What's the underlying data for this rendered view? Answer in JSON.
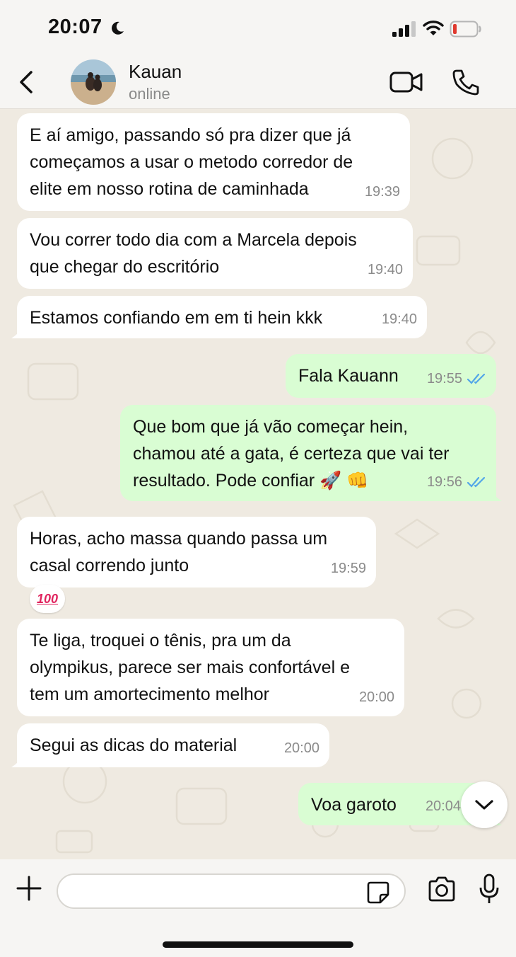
{
  "status_bar": {
    "time": "20:07"
  },
  "header": {
    "contact_name": "Kauan",
    "contact_status": "online"
  },
  "messages": [
    {
      "direction": "in",
      "text": "E aí amigo, passando só pra dizer que já\ncomeçamos a usar o metodo corredor de\nelite em nosso rotina de caminhada",
      "time": "19:39"
    },
    {
      "direction": "in",
      "text": "Vou correr todo dia com a Marcela depois\nque chegar do escritório",
      "time": "19:40"
    },
    {
      "direction": "in",
      "text": "Estamos confiando em em ti hein kkk",
      "time": "19:40"
    },
    {
      "direction": "out",
      "text": "Fala Kauann",
      "time": "19:55"
    },
    {
      "direction": "out",
      "text": "Que bom que já vão começar hein,\nchamou até a gata, é certeza que vai ter\nresultado. Pode confiar 🚀 👊",
      "time": "19:56"
    },
    {
      "direction": "in",
      "text": "Horas, acho massa quando passa um\ncasal correndo junto",
      "time": "19:59",
      "reaction": "💯"
    },
    {
      "direction": "in",
      "text": "Te liga, troquei o tênis, pra um da\nolympikus, parece ser mais confortável e\ntem um amortecimento melhor",
      "time": "20:00"
    },
    {
      "direction": "in",
      "text": "Segui as dicas do material",
      "time": "20:00"
    },
    {
      "direction": "out",
      "text": "Voa garoto",
      "time": "20:04"
    }
  ],
  "reaction_text": "100",
  "composer": {
    "placeholder": ""
  },
  "colors": {
    "incoming": "#ffffff",
    "outgoing": "#d9fdd3",
    "read_ticks": "#53a6e8"
  },
  "icons": [
    "moon-icon",
    "signal-icon",
    "wifi-icon",
    "battery-icon",
    "back-icon",
    "video-icon",
    "phone-icon",
    "plus-icon",
    "sticker-icon",
    "camera-icon",
    "mic-icon",
    "chevron-down-icon"
  ]
}
